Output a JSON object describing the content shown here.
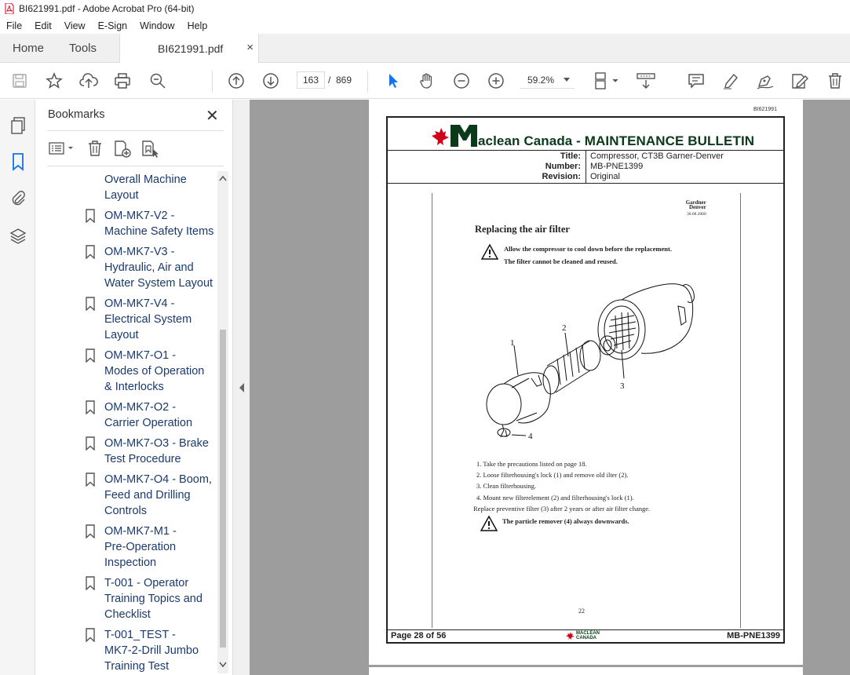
{
  "window": {
    "title": "BI621991.pdf - Adobe Acrobat Pro (64-bit)"
  },
  "menu": [
    "File",
    "Edit",
    "View",
    "E-Sign",
    "Window",
    "Help"
  ],
  "tabs": {
    "home": "Home",
    "tools": "Tools",
    "document": "BI621991.pdf",
    "close": "×"
  },
  "toolbar": {
    "page_current": "163",
    "page_sep": "/",
    "page_total": "869",
    "zoom": "59.2%"
  },
  "bookmarks": {
    "title": "Bookmarks",
    "close": "✕",
    "items": [
      {
        "label": "Overall Machine Layout",
        "lines": [
          "Overall Machine",
          "Layout"
        ]
      },
      {
        "label": "OM-MK7-V2 - Machine Safety Items",
        "lines": [
          "OM-MK7-V2 -",
          "Machine Safety Items"
        ]
      },
      {
        "label": "OM-MK7-V3 - Hydraulic, Air and Water System Layout",
        "lines": [
          "OM-MK7-V3 -",
          "Hydraulic, Air and",
          "Water System Layout"
        ]
      },
      {
        "label": "OM-MK7-V4 - Electrical System Layout",
        "lines": [
          "OM-MK7-V4 -",
          "Electrical System",
          "Layout"
        ]
      },
      {
        "label": "OM-MK7-O1 - Modes of Operation & Interlocks",
        "lines": [
          "OM-MK7-O1 -",
          "Modes of Operation",
          "& Interlocks"
        ]
      },
      {
        "label": "OM-MK7-O2 - Carrier Operation",
        "lines": [
          "OM-MK7-O2 -",
          "Carrier Operation"
        ]
      },
      {
        "label": "OM-MK7-O3 - Brake Test Procedure",
        "lines": [
          "OM-MK7-O3 - Brake",
          "Test Procedure"
        ]
      },
      {
        "label": "OM-MK7-O4 - Boom, Feed and Drilling Controls",
        "lines": [
          "OM-MK7-O4 - Boom,",
          "Feed and Drilling",
          "Controls"
        ]
      },
      {
        "label": "OM-MK7-M1 - Pre-Operation Inspection",
        "lines": [
          "OM-MK7-M1 -",
          "Pre-Operation",
          "Inspection"
        ]
      },
      {
        "label": "T-001 - Operator Training Topics and Checklist",
        "lines": [
          "T-001 - Operator",
          "Training Topics and",
          "Checklist"
        ]
      },
      {
        "label": "T-001_TEST - MK7-2-Drill Jumbo Training Test",
        "lines": [
          "T-001_TEST -",
          "MK7-2-Drill Jumbo",
          "Training Test"
        ]
      }
    ]
  },
  "document": {
    "doc_id": "BI621991",
    "brand": "aclean Canada - MAINTENANCE BULLETIN",
    "title_label": "Title:",
    "title_value": "Compressor, CT3B Garner-Denver",
    "number_label": "Number:",
    "number_value": "MB-PNE1399",
    "revision_label": "Revision:",
    "revision_value": "Original",
    "gd_logo_lines": [
      "Gardner",
      "Denver",
      "30.08.2000"
    ],
    "heading": "Replacing the air filter",
    "warning1": "Allow the compressor to cool down before the replacement.",
    "warning2": "The filter cannot be cleaned and reused.",
    "callouts": [
      "1",
      "2",
      "3",
      "4"
    ],
    "steps": [
      "1.  Take the precautions listed on page 18.",
      "2.  Loose filterhousing's lock (1) and remove old ilter (2).",
      "3.  Clean filterhousing.",
      "4.  Mount new filterelement (2) and filterhousing's lock (1)."
    ],
    "replace_note": "Replace preventive filter (3) after 2 years or after air filter change.",
    "warning3": "The particle remover (4) always downwards.",
    "inner_page": "22",
    "footer_left": "Page 28 of 56",
    "footer_logo": "MACLEAN CANADA",
    "footer_right": "MB-PNE1399"
  }
}
